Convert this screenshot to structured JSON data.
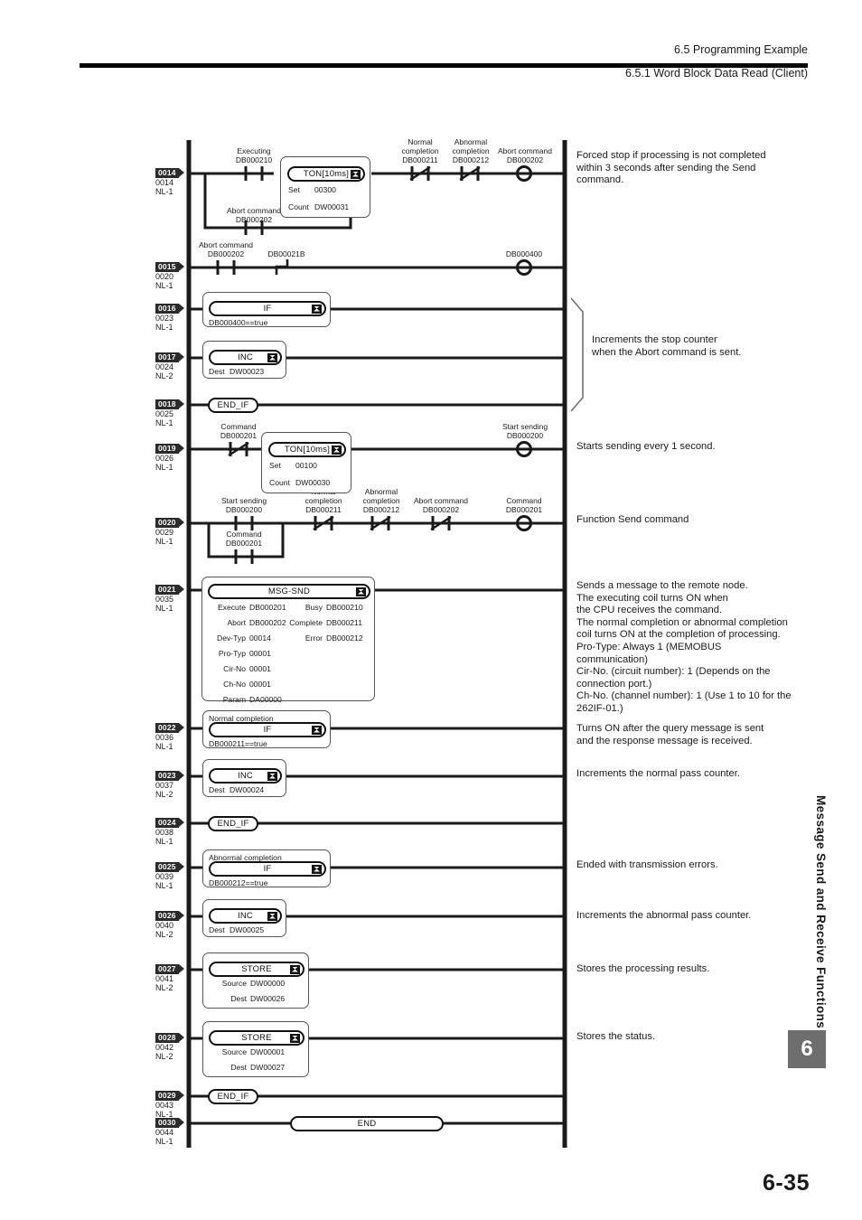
{
  "header": {
    "section": "6.5  Programming Example",
    "subsection": "6.5.1  Word Block Data Read (Client)"
  },
  "footer": {
    "page_number": "6-35",
    "chapter_tab": "6",
    "side_title": "Message Send and Receive Functions"
  },
  "ladder": {
    "rungs": [
      {
        "tag": "0014",
        "step": "0014",
        "nl": "NL-1"
      },
      {
        "tag": "0015",
        "step": "0020",
        "nl": "NL-1"
      },
      {
        "tag": "0016",
        "step": "0023",
        "nl": "NL-1"
      },
      {
        "tag": "0017",
        "step": "0024",
        "nl": "NL-2"
      },
      {
        "tag": "0018",
        "step": "0025",
        "nl": "NL-1"
      },
      {
        "tag": "0019",
        "step": "0026",
        "nl": "NL-1"
      },
      {
        "tag": "0020",
        "step": "0029",
        "nl": "NL-1"
      },
      {
        "tag": "0021",
        "step": "0035",
        "nl": "NL-1"
      },
      {
        "tag": "0022",
        "step": "0036",
        "nl": "NL-1"
      },
      {
        "tag": "0023",
        "step": "0037",
        "nl": "NL-2"
      },
      {
        "tag": "0024",
        "step": "0038",
        "nl": "NL-1"
      },
      {
        "tag": "0025",
        "step": "0039",
        "nl": "NL-1"
      },
      {
        "tag": "0026",
        "step": "0040",
        "nl": "NL-2"
      },
      {
        "tag": "0027",
        "step": "0041",
        "nl": "NL-2"
      },
      {
        "tag": "0028",
        "step": "0042",
        "nl": "NL-2"
      },
      {
        "tag": "0029",
        "step": "0043",
        "nl": "NL-1"
      },
      {
        "tag": "0030",
        "step": "0044",
        "nl": "NL-1"
      }
    ],
    "labels": {
      "executing": "Executing",
      "executing_addr": "DB000210",
      "abort_command": "Abort command",
      "abort_addr": "DB000202",
      "normal_completion": "Normal\ncompletion",
      "normal_addr": "DB000211",
      "abnormal_completion": "Abnormal\ncompletion",
      "abnormal_addr": "DB000212",
      "edge_addr": "DB00021B",
      "coil_400": "DB000400",
      "command": "Command",
      "command_addr": "DB000201",
      "start_sending": "Start sending",
      "start_addr": "DB000200",
      "normal_completion_1": "Normal completion",
      "abnormal_completion_1": "Abnormal completion"
    },
    "blocks": {
      "ton1": {
        "name": "TON[10ms]",
        "rows": [
          {
            "k": "Set",
            "v": "00300"
          },
          {
            "k": "Count",
            "v": "DW00031"
          }
        ]
      },
      "ton2": {
        "name": "TON[10ms]",
        "rows": [
          {
            "k": "Set",
            "v": "00100"
          },
          {
            "k": "Count",
            "v": "DW00030"
          }
        ]
      },
      "if1": {
        "name": "IF",
        "cond": "DB000400==true"
      },
      "inc1": {
        "name": "INC",
        "dest_k": "Dest",
        "dest_v": "DW00023"
      },
      "endif1": {
        "name": "END_IF"
      },
      "msgsnd": {
        "name": "MSG-SND",
        "left": [
          {
            "k": "Execute",
            "v": "DB000201"
          },
          {
            "k": "Abort",
            "v": "DB000202"
          },
          {
            "k": "Dev-Typ",
            "v": "00014"
          },
          {
            "k": "Pro-Typ",
            "v": "00001"
          },
          {
            "k": "Cir-No",
            "v": "00001"
          },
          {
            "k": "Ch-No",
            "v": "00001"
          },
          {
            "k": "Param",
            "v": "DA00000"
          }
        ],
        "right": [
          {
            "k": "Busy",
            "v": "DB000210"
          },
          {
            "k": "Complete",
            "v": "DB000211"
          },
          {
            "k": "Error",
            "v": "DB000212"
          }
        ]
      },
      "if2": {
        "name": "IF",
        "caption": "Normal completion",
        "cond": "DB000211==true"
      },
      "inc2": {
        "name": "INC",
        "dest_k": "Dest",
        "dest_v": "DW00024"
      },
      "endif2": {
        "name": "END_IF"
      },
      "if3": {
        "name": "IF",
        "caption": "Abnormal completion",
        "cond": "DB000212==true"
      },
      "inc3": {
        "name": "INC",
        "dest_k": "Dest",
        "dest_v": "DW00025"
      },
      "store1": {
        "name": "STORE",
        "rows": [
          {
            "k": "Source",
            "v": "DW00000"
          },
          {
            "k": "Dest",
            "v": "DW00026"
          }
        ]
      },
      "store2": {
        "name": "STORE",
        "rows": [
          {
            "k": "Source",
            "v": "DW00001"
          },
          {
            "k": "Dest",
            "v": "DW00027"
          }
        ]
      },
      "endif3": {
        "name": "END_IF"
      },
      "end": {
        "name": "END"
      }
    }
  },
  "notes": {
    "n1": "Forced stop if processing is not completed\nwithin 3 seconds after sending the Send\ncommand.",
    "n2": "Increments the stop counter\nwhen the Abort command is sent.",
    "n3": "Starts sending every 1 second.",
    "n4": "Function Send command",
    "n5": "Sends a message to the remote node.\nThe executing coil turns ON when\nthe CPU receives the command.\nThe normal completion or abnormal completion\ncoil turns ON at the completion of processing.\nPro-Type: Always 1 (MEMOBUS\ncommunication)\nCir-No. (circuit number): 1 (Depends on the\nconnection port.)\nCh-No. (channel number): 1 (Use 1 to 10 for the\n262IF-01.)",
    "n6": "Turns ON after the query message is sent\nand the response message is received.",
    "n7": "Increments the normal pass counter.",
    "n8": "Ended with transmission errors.",
    "n9": "Increments the abnormal pass counter.",
    "n10": "Stores the processing results.",
    "n11": "Stores the status."
  },
  "colors": {
    "rail": "#1a1a1a",
    "tag_bg": "#2b2b2b",
    "chapter_tab_bg": "#6e6e6e"
  }
}
